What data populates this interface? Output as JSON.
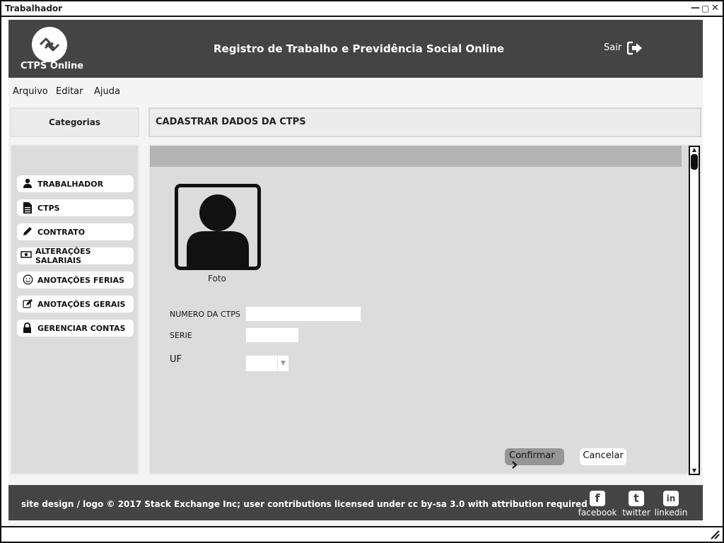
{
  "window": {
    "title": "Trabalhador",
    "minimize_icon": "minimize-icon",
    "maximize_icon": "maximize-icon",
    "close_icon": "close-icon"
  },
  "header": {
    "brand": "CTPS Online",
    "title": "Registro de Trabalho e Previdência Social Online",
    "logout_label": "Sair",
    "logo_icon": "link-logo-icon",
    "logout_icon": "sign-out-icon",
    "background": "#444444"
  },
  "menu": {
    "items": [
      {
        "label": "Arquivo"
      },
      {
        "label": "Editar"
      },
      {
        "label": "Ajuda"
      }
    ]
  },
  "sidebar": {
    "header": "Categorias",
    "items": [
      {
        "label": "TRABALHADOR",
        "icon": "user-icon"
      },
      {
        "label": "CTPS",
        "icon": "document-icon"
      },
      {
        "label": "CONTRATO",
        "icon": "pencil-icon"
      },
      {
        "label": "ALTERAÇÕES SALARIAIS",
        "icon": "money-icon"
      },
      {
        "label": "ANOTAÇÕES FERIAS",
        "icon": "smile-icon"
      },
      {
        "label": "ANOTAÇÕES GERAIS",
        "icon": "edit-icon"
      },
      {
        "label": "GERENCIAR CONTAS",
        "icon": "lock-icon"
      }
    ]
  },
  "main": {
    "page_title": "CADASTRAR DADOS DA CTPS",
    "photo_label": "Foto",
    "form": {
      "numero_label": "NUMERO DA CTPS",
      "numero_value": "",
      "serie_label": "SERIE",
      "serie_value": "",
      "uf_label": "UF",
      "uf_value": ""
    },
    "confirm_label": "Confirmar",
    "cancel_label": "Cancelar"
  },
  "footer": {
    "copyright": "site design / logo © 2017 Stack Exchange Inc; user contributions licensed under cc by-sa 3.0 with attribution required",
    "social": [
      {
        "label": "facebook",
        "icon": "facebook-icon",
        "glyph": "f"
      },
      {
        "label": "twitter",
        "icon": "twitter-icon",
        "glyph": "t"
      },
      {
        "label": "linkedin",
        "icon": "linkedin-icon",
        "glyph": "in"
      }
    ]
  }
}
